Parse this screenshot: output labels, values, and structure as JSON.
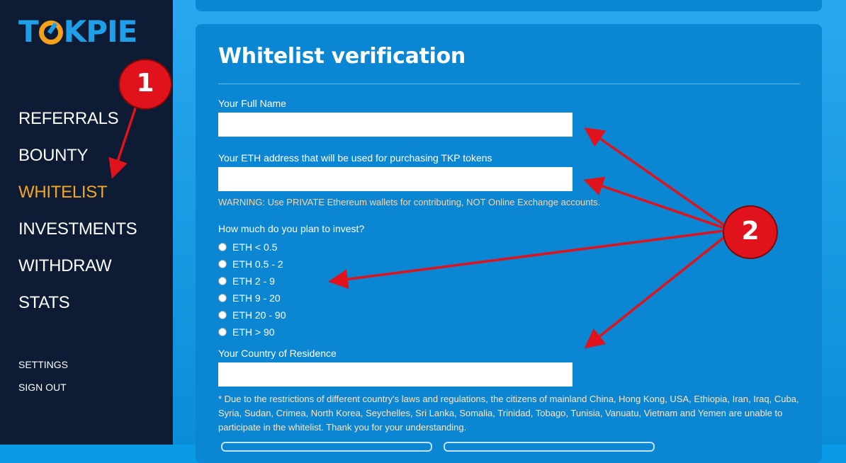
{
  "sidebar": {
    "logo": {
      "left": "T",
      "right": "KPIE"
    },
    "nav": [
      {
        "label": "REFERRALS",
        "active": false
      },
      {
        "label": "BOUNTY",
        "active": false
      },
      {
        "label": "WHITELIST",
        "active": true
      },
      {
        "label": "INVESTMENTS",
        "active": false
      },
      {
        "label": "WITHDRAW",
        "active": false
      },
      {
        "label": "STATS",
        "active": false
      }
    ],
    "settings_label": "SETTINGS",
    "signout_label": "SIGN OUT"
  },
  "form": {
    "title": "Whitelist verification",
    "full_name_label": "Your Full Name",
    "full_name_value": "",
    "eth_label": "Your ETH address that will be used for purchasing TKP tokens",
    "eth_value": "",
    "warning": "WARNING: Use PRIVATE Ethereum wallets for contributing, NOT Online Exchange accounts.",
    "invest_label": "How much do you plan to invest?",
    "invest_options": [
      "ETH < 0.5",
      "ETH 0.5 - 2",
      "ETH 2 - 9",
      "ETH 9 - 20",
      "ETH 20 - 90",
      "ETH > 90"
    ],
    "country_label": "Your Country of Residence",
    "country_value": "",
    "note": "* Due to the restrictions of different country's laws and regulations, the citizens of mainland China, Hong Kong, USA, Ethiopia, Iran, Iraq, Cuba, Syria, Sudan, Crimea, North Korea, Seychelles, Sri Lanka, Somalia, Trinidad, Tobago, Tunisia, Vanuatu, Vietnam and Yemen are unable to participate in the whitelist. Thank you for your understanding."
  },
  "annotations": {
    "badge1": "1",
    "badge2": "2",
    "color": "#e0121b"
  },
  "colors": {
    "sidebar_bg": "#0d1b35",
    "accent": "#f5a623",
    "main_bg": "#0b86d2",
    "warning_text": "#ffd3a8"
  }
}
